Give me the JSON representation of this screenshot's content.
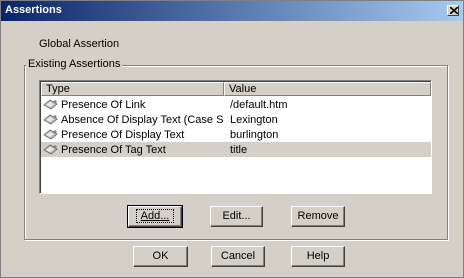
{
  "window": {
    "title": "Assertions"
  },
  "global_label": "Global Assertion",
  "group": {
    "label": "Existing Assertions"
  },
  "list": {
    "columns": [
      "Type",
      "Value"
    ],
    "rows": [
      {
        "type": "Presence Of Link",
        "value": "/default.htm",
        "selected": false
      },
      {
        "type": "Absence Of Display Text (Case Sen...",
        "value": "Lexington",
        "selected": false
      },
      {
        "type": "Presence Of Display Text",
        "value": "burlington",
        "selected": false
      },
      {
        "type": "Presence Of Tag Text",
        "value": "title",
        "selected": true
      }
    ]
  },
  "buttons": {
    "add": "Add...",
    "edit": "Edit...",
    "remove": "Remove",
    "ok": "OK",
    "cancel": "Cancel",
    "help": "Help"
  }
}
